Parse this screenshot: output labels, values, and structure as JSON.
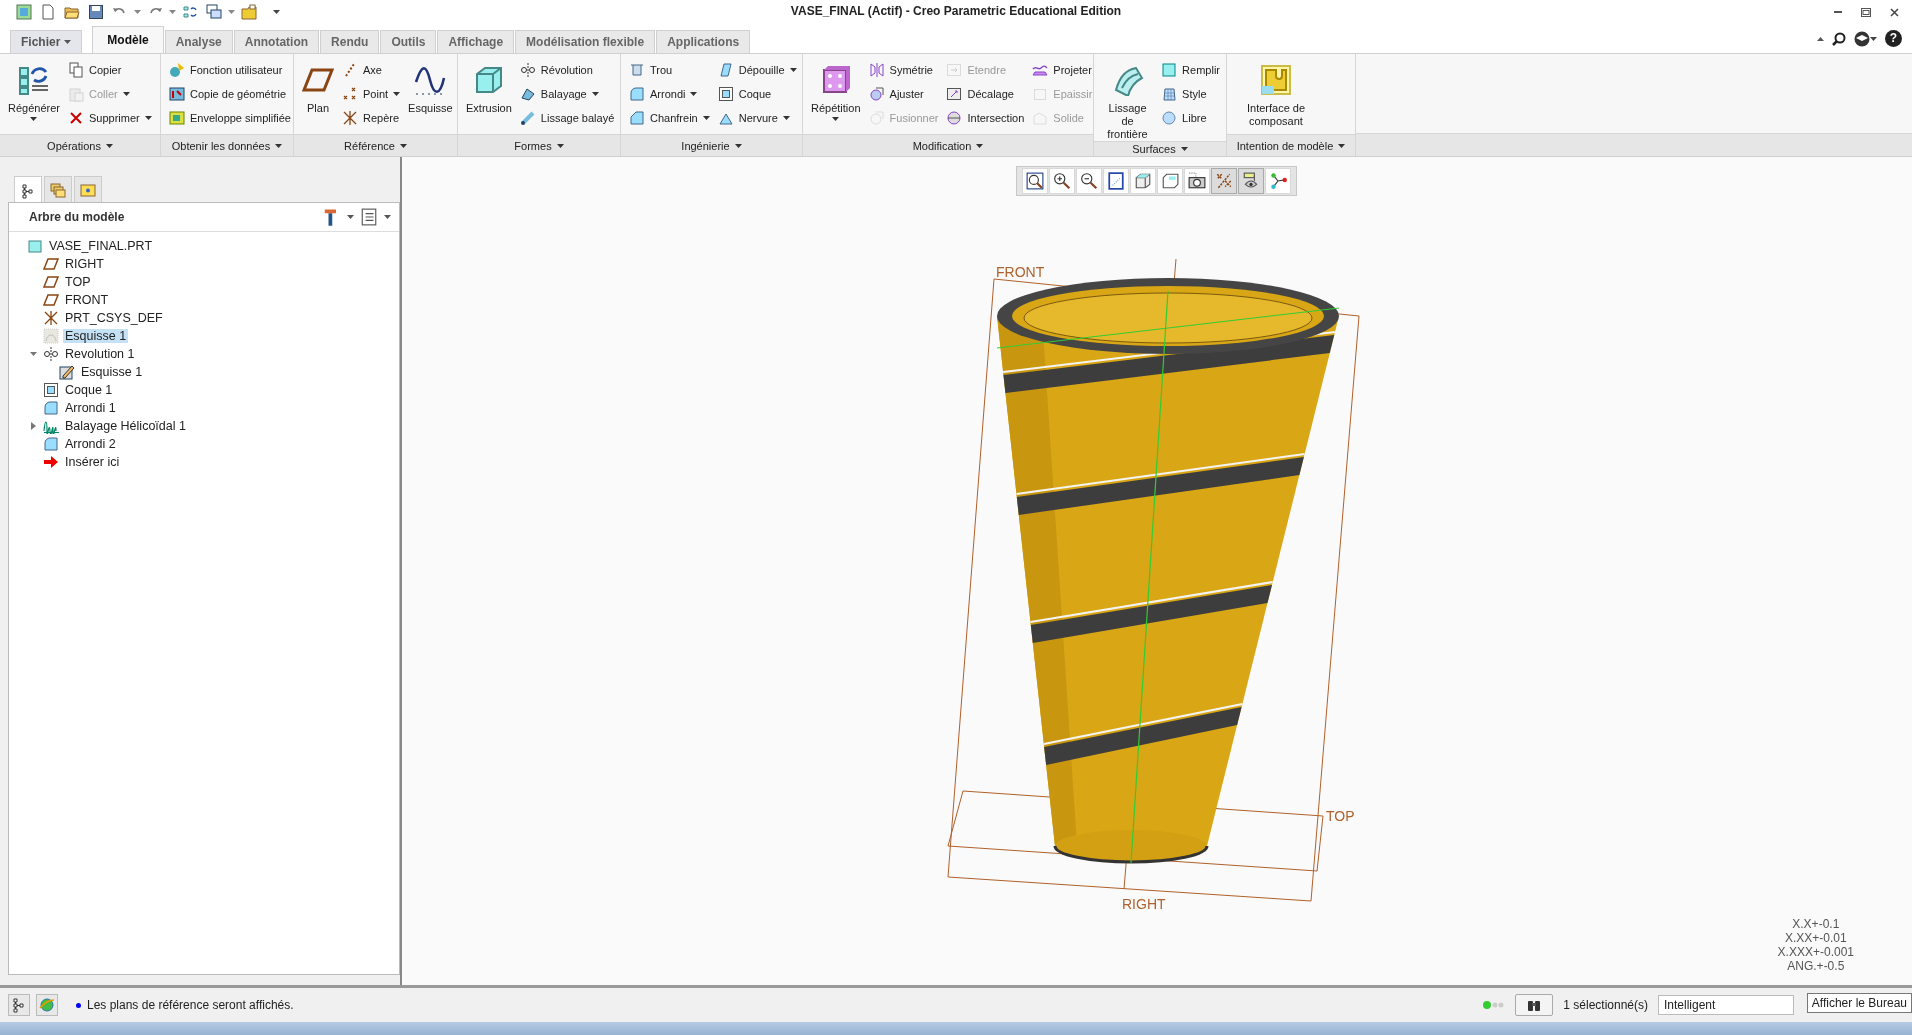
{
  "window": {
    "title": "VASE_FINAL (Actif) - Creo Parametric Educational Edition",
    "help": "?"
  },
  "ribbon": {
    "tabs": [
      {
        "label": "Fichier",
        "kind": "menu",
        "selected": false
      },
      {
        "label": "Modèle",
        "kind": "tab",
        "selected": true
      },
      {
        "label": "Analyse",
        "kind": "tab",
        "selected": false
      },
      {
        "label": "Annotation",
        "kind": "tab",
        "selected": false
      },
      {
        "label": "Rendu",
        "kind": "tab",
        "selected": false
      },
      {
        "label": "Outils",
        "kind": "tab",
        "selected": false
      },
      {
        "label": "Affichage",
        "kind": "tab",
        "selected": false
      },
      {
        "label": "Modélisation flexible",
        "kind": "tab",
        "selected": false
      },
      {
        "label": "Applications",
        "kind": "tab",
        "selected": false
      }
    ],
    "groups": [
      {
        "label": "Opérations",
        "columns": [
          {
            "kind": "large",
            "tools": [
              {
                "label": "Régénérer",
                "disabled": false,
                "dropdown": true
              }
            ]
          },
          {
            "kind": "stack",
            "tools": [
              {
                "label": "Copier",
                "disabled": false,
                "dropdown": false
              },
              {
                "label": "Coller",
                "disabled": true,
                "dropdown": true
              },
              {
                "label": "Supprimer",
                "disabled": false,
                "dropdown": true
              }
            ]
          }
        ]
      },
      {
        "label": "Obtenir les données",
        "columns": [
          {
            "kind": "stack",
            "tools": [
              {
                "label": "Fonction utilisateur",
                "disabled": false,
                "dropdown": false
              },
              {
                "label": "Copie de géométrie",
                "disabled": false,
                "dropdown": false
              },
              {
                "label": "Enveloppe simplifiée",
                "disabled": false,
                "dropdown": false
              }
            ]
          }
        ]
      },
      {
        "label": "Référence",
        "columns": [
          {
            "kind": "large",
            "tools": [
              {
                "label": "Plan",
                "disabled": false,
                "dropdown": false
              }
            ]
          },
          {
            "kind": "stack",
            "tools": [
              {
                "label": "Axe",
                "disabled": false,
                "dropdown": false
              },
              {
                "label": "Point",
                "disabled": false,
                "dropdown": true
              },
              {
                "label": "Repère",
                "disabled": false,
                "dropdown": false
              }
            ]
          },
          {
            "kind": "large",
            "tools": [
              {
                "label": "Esquisse",
                "disabled": false,
                "dropdown": false
              }
            ]
          }
        ]
      },
      {
        "label": "Formes",
        "columns": [
          {
            "kind": "large",
            "tools": [
              {
                "label": "Extrusion",
                "disabled": false,
                "dropdown": false
              }
            ]
          },
          {
            "kind": "stack",
            "tools": [
              {
                "label": "Révolution",
                "disabled": false,
                "dropdown": false
              },
              {
                "label": "Balayage",
                "disabled": false,
                "dropdown": true
              },
              {
                "label": "Lissage balayé",
                "disabled": false,
                "dropdown": false
              }
            ]
          }
        ]
      },
      {
        "label": "Ingénierie",
        "columns": [
          {
            "kind": "stack",
            "tools": [
              {
                "label": "Trou",
                "disabled": false,
                "dropdown": false
              },
              {
                "label": "Arrondi",
                "disabled": false,
                "dropdown": true
              },
              {
                "label": "Chanfrein",
                "disabled": false,
                "dropdown": true
              }
            ]
          },
          {
            "kind": "stack",
            "tools": [
              {
                "label": "Dépouille",
                "disabled": false,
                "dropdown": true
              },
              {
                "label": "Coque",
                "disabled": false,
                "dropdown": false
              },
              {
                "label": "Nervure",
                "disabled": false,
                "dropdown": true
              }
            ]
          }
        ]
      },
      {
        "label": "Modification",
        "columns": [
          {
            "kind": "large",
            "tools": [
              {
                "label": "Répétition",
                "disabled": false,
                "dropdown": true
              }
            ]
          },
          {
            "kind": "stack",
            "tools": [
              {
                "label": "Symétrie",
                "disabled": false,
                "dropdown": false
              },
              {
                "label": "Ajuster",
                "disabled": false,
                "dropdown": false
              },
              {
                "label": "Fusionner",
                "disabled": true,
                "dropdown": false
              }
            ]
          },
          {
            "kind": "stack",
            "tools": [
              {
                "label": "Etendre",
                "disabled": true,
                "dropdown": false
              },
              {
                "label": "Décalage",
                "disabled": false,
                "dropdown": false
              },
              {
                "label": "Intersection",
                "disabled": false,
                "dropdown": false
              }
            ]
          },
          {
            "kind": "stack",
            "tools": [
              {
                "label": "Projeter",
                "disabled": false,
                "dropdown": false
              },
              {
                "label": "Epaissir",
                "disabled": true,
                "dropdown": false
              },
              {
                "label": "Solide",
                "disabled": true,
                "dropdown": false
              }
            ]
          }
        ]
      },
      {
        "label": "Surfaces",
        "columns": [
          {
            "kind": "large",
            "tools": [
              {
                "label": "Lissage de frontière",
                "disabled": false,
                "dropdown": false
              }
            ]
          },
          {
            "kind": "stack",
            "tools": [
              {
                "label": "Remplir",
                "disabled": false,
                "dropdown": false
              },
              {
                "label": "Style",
                "disabled": false,
                "dropdown": false
              },
              {
                "label": "Libre",
                "disabled": false,
                "dropdown": false
              }
            ]
          }
        ]
      },
      {
        "label": "Intention de modèle",
        "columns": [
          {
            "kind": "large",
            "tools": [
              {
                "label": "Interface de composant",
                "disabled": false,
                "dropdown": false
              }
            ]
          }
        ]
      }
    ]
  },
  "navigator": {
    "tabs": [
      {
        "selected": true
      },
      {
        "selected": false
      },
      {
        "selected": false
      }
    ],
    "title": "Arbre du modèle",
    "tree": [
      {
        "label": "VASE_FINAL.PRT",
        "kind": "part",
        "selected": false,
        "children": [
          {
            "label": "RIGHT",
            "kind": "plane",
            "selected": false
          },
          {
            "label": "TOP",
            "kind": "plane",
            "selected": false
          },
          {
            "label": "FRONT",
            "kind": "plane",
            "selected": false
          },
          {
            "label": "PRT_CSYS_DEF",
            "kind": "csys",
            "selected": false
          },
          {
            "label": "Esquisse 1",
            "kind": "sketch",
            "selected": true
          },
          {
            "label": "Revolution 1",
            "kind": "revolve",
            "selected": false,
            "expanded": true,
            "children": [
              {
                "label": "Esquisse 1",
                "kind": "internal-sketch",
                "selected": false
              }
            ]
          },
          {
            "label": "Coque 1",
            "kind": "shell",
            "selected": false
          },
          {
            "label": "Arrondi 1",
            "kind": "round",
            "selected": false
          },
          {
            "label": "Balayage Hélicoïdal 1",
            "kind": "helical-sweep",
            "selected": false,
            "expanded": false
          },
          {
            "label": "Arrondi 2",
            "kind": "round",
            "selected": false
          },
          {
            "label": "Insérer ici",
            "kind": "insert",
            "selected": false
          }
        ]
      }
    ]
  },
  "viewport": {
    "view_toolbar": [
      {
        "pressed": false
      },
      {
        "pressed": false
      },
      {
        "pressed": false
      },
      {
        "pressed": false
      },
      {
        "pressed": false
      },
      {
        "pressed": false
      },
      {
        "pressed": false
      },
      {
        "pressed": true
      },
      {
        "pressed": true
      },
      {
        "pressed": false
      }
    ],
    "datum_labels": [
      "FRONT",
      "TOP",
      "RIGHT"
    ],
    "tolerances": [
      "X.X+-0.1",
      "X.XX+-0.01",
      "X.XXX+-0.001",
      "ANG.+-0.5"
    ]
  },
  "status_bar": {
    "message": "Les plans de référence seront affichés.",
    "selection": "1 sélectionné(s)",
    "filter": "Intelligent",
    "tooltip": "Afficher le Bureau"
  }
}
